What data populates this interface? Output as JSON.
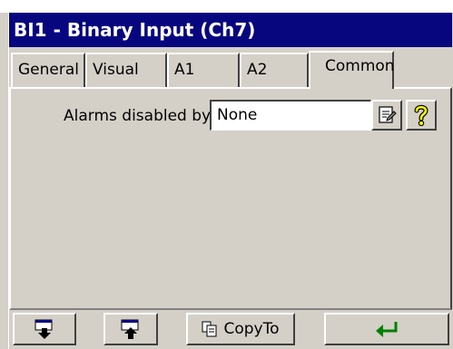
{
  "window": {
    "title": "BI1 - Binary Input (Ch7)"
  },
  "tabs": [
    {
      "label": "General",
      "active": false
    },
    {
      "label": "Visual",
      "active": false
    },
    {
      "label": "A1",
      "active": false
    },
    {
      "label": "A2",
      "active": false
    },
    {
      "label": "Common",
      "active": true
    }
  ],
  "form": {
    "alarms_disabled_label": "Alarms disabled by:",
    "alarms_disabled_value": "None"
  },
  "icons": {
    "properties": "properties-icon",
    "help": "help-question-icon",
    "move_down": "move-down-icon",
    "move_up": "move-up-icon",
    "copy": "copy-icon",
    "enter": "enter-arrow-icon"
  },
  "toolbar": {
    "copyto_label": "CopyTo"
  },
  "colors": {
    "titlebar": "#08067e",
    "face": "#d4d0c8",
    "help_yellow": "#ffff00",
    "enter_green": "#008000"
  }
}
